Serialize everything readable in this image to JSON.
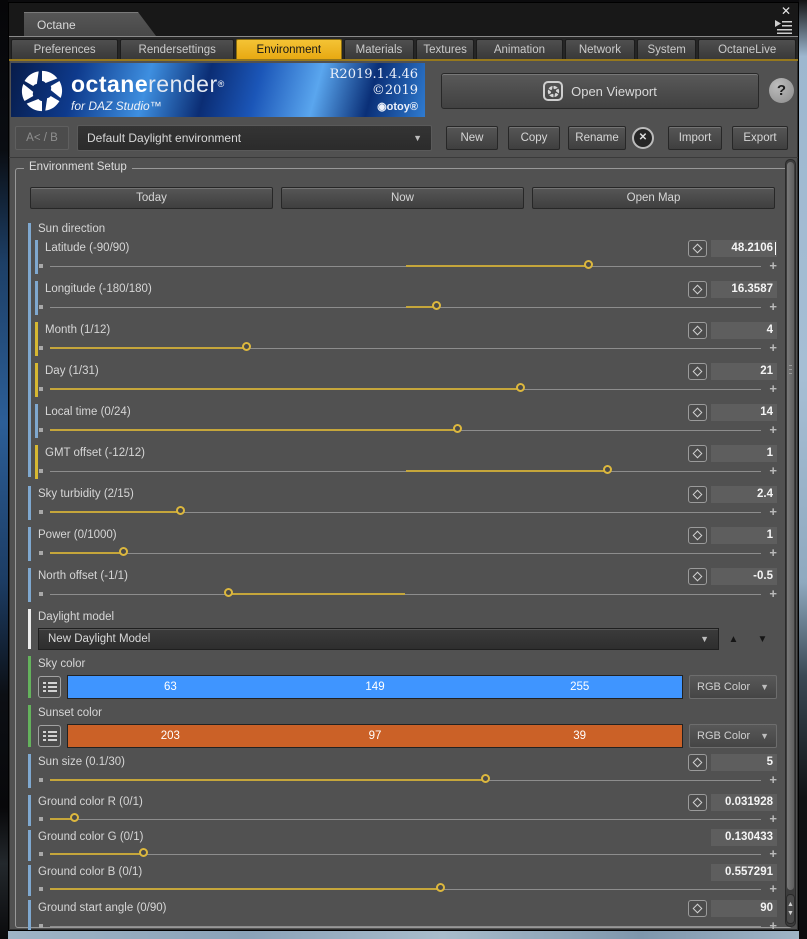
{
  "window": {
    "doc_tab": "Octane"
  },
  "icons": {
    "close": "✕",
    "dropdown_arrow": "▼",
    "up_arrow": "▲",
    "down_arrow": "▼",
    "plus": "+",
    "fisheye": "◉",
    "help": "?"
  },
  "tabs": [
    {
      "label": "Preferences",
      "active": false
    },
    {
      "label": "Rendersettings",
      "active": false
    },
    {
      "label": "Environment",
      "active": true
    },
    {
      "label": "Materials",
      "active": false
    },
    {
      "label": "Textures",
      "active": false
    },
    {
      "label": "Animation",
      "active": false
    },
    {
      "label": "Network",
      "active": false
    },
    {
      "label": "System",
      "active": false
    },
    {
      "label": "OctaneLive",
      "active": false
    }
  ],
  "banner": {
    "brand_bold": "octane",
    "brand_light": "render",
    "reg": "®",
    "subtitle": "for DAZ Studio™",
    "version": "R2019.1.4.46",
    "copyright": "©2019",
    "otoy": "otoy®",
    "open_viewport": "Open Viewport",
    "help": "?"
  },
  "preset_bar": {
    "ab": "A< / B",
    "value": "Default Daylight environment",
    "new": "New",
    "copy": "Copy",
    "rename": "Rename",
    "import": "Import",
    "export": "Export"
  },
  "environment_setup": {
    "legend": "Environment Setup",
    "today": "Today",
    "now": "Now",
    "open_map": "Open Map"
  },
  "params": [
    {
      "kind": "group",
      "label": "Sun direction"
    },
    {
      "kind": "slider",
      "label": "Latitude (-90/90)",
      "value": "48.2106",
      "slider": {
        "fill_start": 50,
        "fill_end": 75.9,
        "handle": 75.9
      }
    },
    {
      "kind": "slider",
      "label": "Longitude (-180/180)",
      "value": "16.3587",
      "slider": {
        "fill_start": 50,
        "fill_end": 54.6,
        "handle": 54.6
      }
    },
    {
      "kind": "slider",
      "label": "Month (1/12)",
      "value": "4",
      "slider": {
        "fill_start": 0,
        "fill_end": 27.9,
        "handle": 27.9
      }
    },
    {
      "kind": "slider",
      "label": "Day (1/31)",
      "value": "21",
      "slider": {
        "fill_start": 0,
        "fill_end": 66.4,
        "handle": 66.4
      }
    },
    {
      "kind": "slider",
      "label": "Local time (0/24)",
      "value": "14",
      "slider": {
        "fill_start": 0,
        "fill_end": 57.5,
        "handle": 57.5
      }
    },
    {
      "kind": "slider",
      "label": "GMT offset (-12/12)",
      "value": "1",
      "slider": {
        "fill_start": 50,
        "fill_end": 78.6,
        "handle": 78.6
      }
    },
    {
      "kind": "slider",
      "label": "Sky turbidity (2/15)",
      "value": "2.4",
      "slider": {
        "fill_start": 0,
        "fill_end": 18.5,
        "handle": 18.5
      }
    },
    {
      "kind": "slider",
      "label": "Power (0/1000)",
      "value": "1",
      "slider": {
        "fill_start": 0,
        "fill_end": 10.5,
        "handle": 10.5
      }
    },
    {
      "kind": "slider",
      "label": "North offset (-1/1)",
      "value": "-0.5",
      "slider": {
        "fill_start": 25.3,
        "fill_end": 50,
        "handle": 25.3
      }
    },
    {
      "kind": "dropdown",
      "label": "Daylight model",
      "value": "New Daylight Model"
    },
    {
      "kind": "color",
      "label": "Sky color",
      "r": "63",
      "g": "149",
      "b": "255",
      "hex": "#3f95ff",
      "mode": "RGB Color"
    },
    {
      "kind": "color",
      "label": "Sunset color",
      "r": "203",
      "g": "97",
      "b": "39",
      "hex": "#cb6127",
      "mode": "RGB Color"
    },
    {
      "kind": "slider",
      "label": "Sun size (0.1/30)",
      "value": "5",
      "slider": {
        "fill_start": 0,
        "fill_end": 61.5,
        "handle": 61.5
      }
    },
    {
      "kind": "slider",
      "label": "Ground color R (0/1)",
      "value": "0.031928",
      "slider": {
        "fill_start": 0,
        "fill_end": 3.7,
        "handle": 3.7
      }
    },
    {
      "kind": "slider",
      "label": "Ground color G (0/1)",
      "value": "0.130433",
      "slider": {
        "fill_start": 0,
        "fill_end": 13.4,
        "handle": 13.4
      }
    },
    {
      "kind": "slider",
      "label": "Ground color B (0/1)",
      "value": "0.557291",
      "slider": {
        "fill_start": 0,
        "fill_end": 55.2,
        "handle": 55.2
      }
    },
    {
      "kind": "slider",
      "label": "Ground start angle (0/90)",
      "value": "90"
    }
  ],
  "colors": {
    "tab_active": "#efb11c",
    "slider_yellow": "#c5a63b",
    "accent_blue": "#7fa8cf",
    "accent_yellow": "#d6b832",
    "accent_green": "#64b25c",
    "accent_white": "#ececec",
    "sky_color": "#3f95ff",
    "sunset_color": "#cb6127"
  }
}
